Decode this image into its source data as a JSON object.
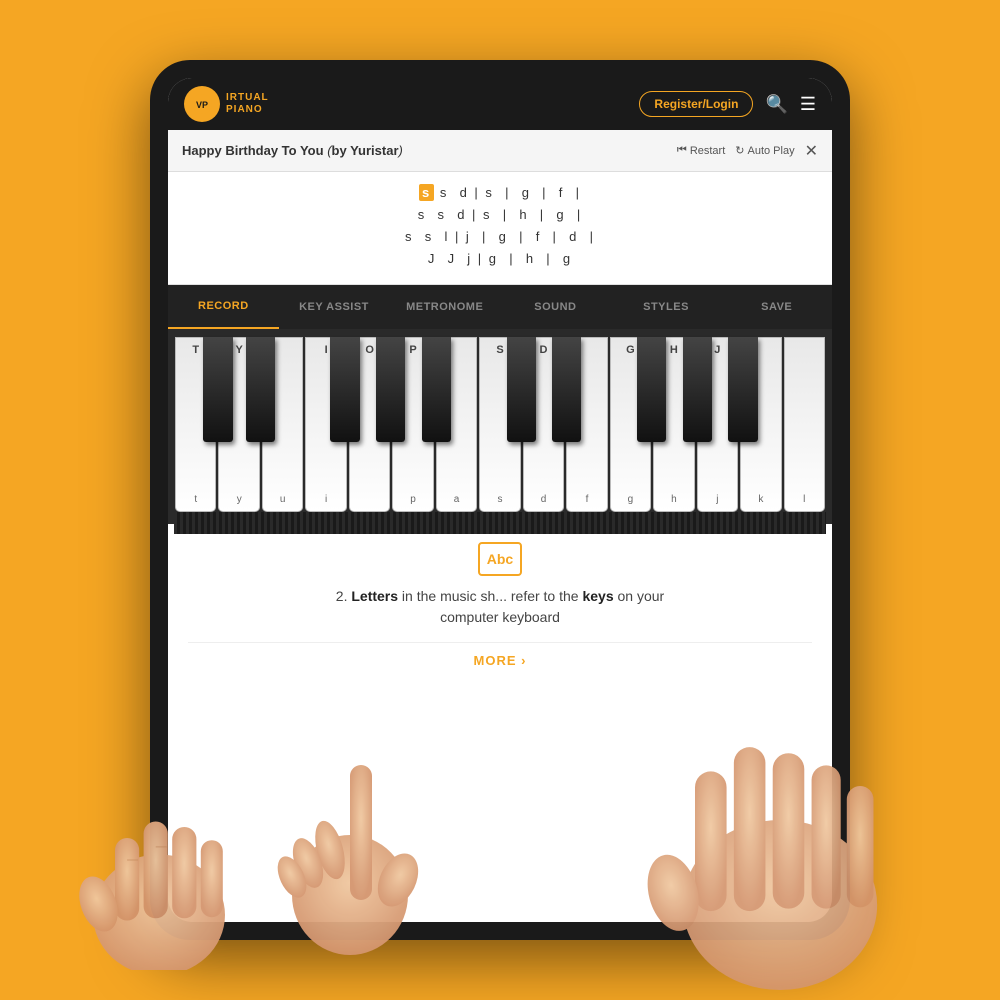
{
  "page": {
    "background_color": "#F5A623"
  },
  "header": {
    "logo_text": "IRTUAL\nPIANO",
    "register_label": "Register/Login",
    "search_icon": "🔍",
    "menu_icon": "☰"
  },
  "song_bar": {
    "title": "Happy Birthday To You",
    "author": "by Yuristar",
    "restart_label": "Restart",
    "autoplay_label": "Auto Play",
    "close_label": "✕"
  },
  "sheet": {
    "lines": [
      "s  s  d | s  |  g  |  f  |",
      "s  s  d | s  |  h  |  g  |",
      "s  s  l | j  |  g  |  f  |  d  |",
      "J  J  j | g  |  h  |  g"
    ],
    "highlighted_char": "s"
  },
  "toolbar": {
    "items": [
      {
        "id": "record",
        "label": "RECORD",
        "active": true
      },
      {
        "id": "key_assist",
        "label": "KEY ASSIST",
        "active": false
      },
      {
        "id": "metronome",
        "label": "METRONOME",
        "active": false
      },
      {
        "id": "sound",
        "label": "SOUND",
        "active": false
      },
      {
        "id": "styles",
        "label": "STYLES",
        "active": false
      },
      {
        "id": "save",
        "label": "SAVE",
        "active": false
      }
    ]
  },
  "piano": {
    "white_keys": [
      {
        "top": "T",
        "bot": "t"
      },
      {
        "top": "Y",
        "bot": "y"
      },
      {
        "top": "",
        "bot": "u"
      },
      {
        "top": "I",
        "bot": "i"
      },
      {
        "top": "O",
        "bot": ""
      },
      {
        "top": "P",
        "bot": "p"
      },
      {
        "top": "",
        "bot": "a"
      },
      {
        "top": "S",
        "bot": "s"
      },
      {
        "top": "D",
        "bot": "d"
      },
      {
        "top": "",
        "bot": "f"
      },
      {
        "top": "G",
        "bot": "g"
      },
      {
        "top": "H",
        "bot": "h"
      },
      {
        "top": "J",
        "bot": "j"
      },
      {
        "top": "",
        "bot": "k"
      },
      {
        "top": "",
        "bot": "l"
      }
    ]
  },
  "info_panel": {
    "abc_label": "Abc",
    "instruction_text": "2. Letters in the music sh... refer to the keys on your computer keyboard",
    "more_label": "MORE ›"
  }
}
